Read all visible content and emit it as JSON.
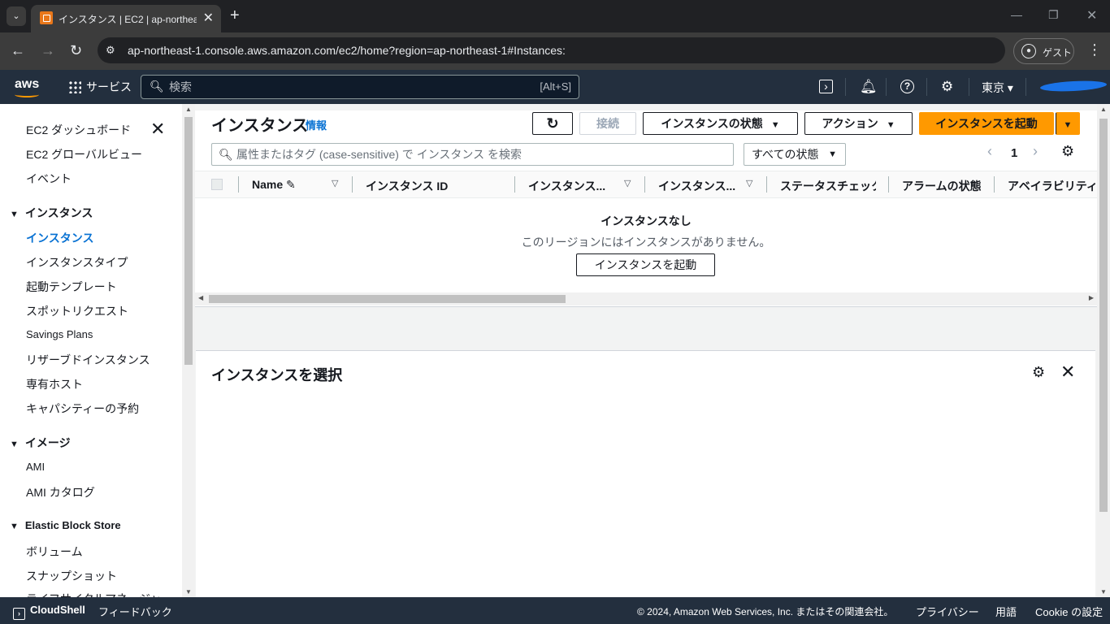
{
  "browser": {
    "tab_title": "インスタンス | EC2 | ap-northeast-1",
    "url": "ap-northeast-1.console.aws.amazon.com/ec2/home?region=ap-northeast-1#Instances:",
    "guest_label": "ゲスト"
  },
  "aws_nav": {
    "logo": "aws",
    "services_label": "サービス",
    "search_placeholder": "検索",
    "search_shortcut": "[Alt+S]",
    "region": "東京 ▾"
  },
  "sidebar": {
    "top_items": [
      "EC2 ダッシュボード",
      "EC2 グローバルビュー",
      "イベント"
    ],
    "sections": [
      {
        "title": "インスタンス",
        "items": [
          "インスタンス",
          "インスタンスタイプ",
          "起動テンプレート",
          "スポットリクエスト",
          "Savings Plans",
          "リザーブドインスタンス",
          "専有ホスト",
          "キャパシティーの予約"
        ]
      },
      {
        "title": "イメージ",
        "items": [
          "AMI",
          "AMI カタログ"
        ]
      },
      {
        "title": "Elastic Block Store",
        "items": [
          "ボリューム",
          "スナップショット",
          "ライフサイクルマネージャー"
        ]
      }
    ]
  },
  "instances_panel": {
    "title": "インスタンス",
    "info_link": "情報",
    "buttons": {
      "connect": "接続",
      "state": "インスタンスの状態",
      "actions": "アクション",
      "launch": "インスタンスを起動"
    },
    "filter_placeholder": "属性またはタグ (case-sensitive) で インスタンス を検索",
    "state_filter": "すべての状態",
    "page_number": "1",
    "columns": [
      "Name",
      "インスタンス ID",
      "インスタンス...",
      "インスタンス...",
      "ステータスチェック",
      "アラームの状態",
      "アベイラビリティー"
    ],
    "empty_title": "インスタンスなし",
    "empty_message": "このリージョンにはインスタンスがありません。",
    "empty_button": "インスタンスを起動"
  },
  "detail_panel": {
    "title": "インスタンスを選択"
  },
  "footer": {
    "cloudshell": "CloudShell",
    "feedback": "フィードバック",
    "copyright": "© 2024, Amazon Web Services, Inc. またはその関連会社。",
    "privacy": "プライバシー",
    "terms": "用語",
    "cookie": "Cookie の設定"
  },
  "colors": {
    "aws_nav_bg": "#232f3e",
    "primary_button": "#ff9900",
    "link_blue": "#0972d3"
  }
}
